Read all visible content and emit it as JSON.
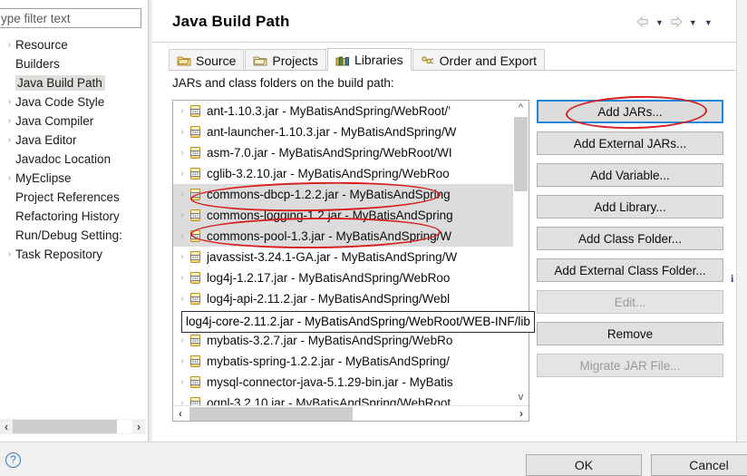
{
  "window": {
    "title": "Java Build Path"
  },
  "filter": {
    "placeholder": "type filter text",
    "value": "ype filter text"
  },
  "sidebar": {
    "items": [
      {
        "label": "Resource",
        "expandable": true,
        "selected": false
      },
      {
        "label": "Builders",
        "expandable": false,
        "selected": false
      },
      {
        "label": "Java Build Path",
        "expandable": false,
        "selected": true
      },
      {
        "label": "Java Code Style",
        "expandable": true,
        "selected": false
      },
      {
        "label": "Java Compiler",
        "expandable": true,
        "selected": false
      },
      {
        "label": "Java Editor",
        "expandable": true,
        "selected": false
      },
      {
        "label": "Javadoc Location",
        "expandable": false,
        "selected": false
      },
      {
        "label": "MyEclipse",
        "expandable": true,
        "selected": false
      },
      {
        "label": "Project References",
        "expandable": false,
        "selected": false
      },
      {
        "label": "Refactoring History",
        "expandable": false,
        "selected": false
      },
      {
        "label": "Run/Debug Setting:",
        "expandable": false,
        "selected": false
      },
      {
        "label": "Task Repository",
        "expandable": true,
        "selected": false
      }
    ]
  },
  "tabs": [
    {
      "label": "Source",
      "icon": "source-folder-icon",
      "active": false
    },
    {
      "label": "Projects",
      "icon": "projects-folder-icon",
      "active": false
    },
    {
      "label": "Libraries",
      "icon": "libraries-books-icon",
      "active": true
    },
    {
      "label": "Order and Export",
      "icon": "order-export-icon",
      "active": false
    }
  ],
  "main": {
    "list_caption": "JARs and class folders on the build path:",
    "jars": [
      {
        "text": "ant-1.10.3.jar - MyBatisAndSpring/WebRoot/’",
        "expandable": true,
        "selected": false,
        "focused": false
      },
      {
        "text": "ant-launcher-1.10.3.jar - MyBatisAndSpring/W",
        "expandable": true,
        "selected": false,
        "focused": false
      },
      {
        "text": "asm-7.0.jar - MyBatisAndSpring/WebRoot/WI",
        "expandable": true,
        "selected": false,
        "focused": false
      },
      {
        "text": "cglib-3.2.10.jar - MyBatisAndSpring/WebRoo",
        "expandable": true,
        "selected": false,
        "focused": false
      },
      {
        "text": "commons-dbcp-1.2.2.jar - MyBatisAndSpring",
        "expandable": true,
        "selected": true,
        "focused": false
      },
      {
        "text": "commons-logging-1.2.jar - MyBatisAndSpring",
        "expandable": true,
        "selected": true,
        "focused": false
      },
      {
        "text": "commons-pool-1.3.jar - MyBatisAndSpring/W",
        "expandable": true,
        "selected": true,
        "focused": false
      },
      {
        "text": "javassist-3.24.1-GA.jar - MyBatisAndSpring/W",
        "expandable": true,
        "selected": false,
        "focused": false
      },
      {
        "text": "log4j-1.2.17.jar - MyBatisAndSpring/WebRoo",
        "expandable": true,
        "selected": false,
        "focused": false
      },
      {
        "text": "log4j-api-2.11.2.jar - MyBatisAndSpring/Webl",
        "expandable": true,
        "selected": false,
        "focused": false
      },
      {
        "text": "log4j-core-2.11.2.jar - MyBatisAndSpring/WebRo",
        "expandable": true,
        "selected": false,
        "focused": true
      },
      {
        "text": "mybatis-3.2.7.jar - MyBatisAndSpring/WebRo",
        "expandable": true,
        "selected": false,
        "focused": false
      },
      {
        "text": "mybatis-spring-1.2.2.jar - MyBatisAndSpring/",
        "expandable": true,
        "selected": false,
        "focused": false
      },
      {
        "text": "mysql-connector-java-5.1.29-bin.jar - MyBatis",
        "expandable": true,
        "selected": false,
        "focused": false
      },
      {
        "text": "ognl-3.2.10.jar - MyBatisAndSpring/WebRoot",
        "expandable": true,
        "selected": false,
        "focused": false
      }
    ],
    "tooltip": "log4j-core-2.11.2.jar - MyBatisAndSpring/WebRoot/WEB-INF/lib"
  },
  "side_buttons": [
    {
      "label": "Add JARs...",
      "state": "focused"
    },
    {
      "label": "Add External JARs...",
      "state": "normal"
    },
    {
      "label": "Add Variable...",
      "state": "normal"
    },
    {
      "label": "Add Library...",
      "state": "normal"
    },
    {
      "label": "Add Class Folder...",
      "state": "normal"
    },
    {
      "label": "Add External Class Folder...",
      "state": "normal"
    },
    {
      "label": "Edit...",
      "state": "disabled"
    },
    {
      "label": "Remove",
      "state": "normal"
    },
    {
      "label": "Migrate JAR File...",
      "state": "disabled"
    }
  ],
  "footer": {
    "help_label": "?",
    "ok_label": "OK",
    "cancel_label": "Cancel"
  },
  "nav": {
    "back_label": "⇦",
    "forward_label": "⇨",
    "caret_label": "▼"
  },
  "info_glyph": "i",
  "colors": {
    "accent_focus": "#1a86d8",
    "annotation_red": "#d61f1f",
    "selection_grey": "#dcdcdc",
    "dialog_grey": "#f0f0f0"
  }
}
